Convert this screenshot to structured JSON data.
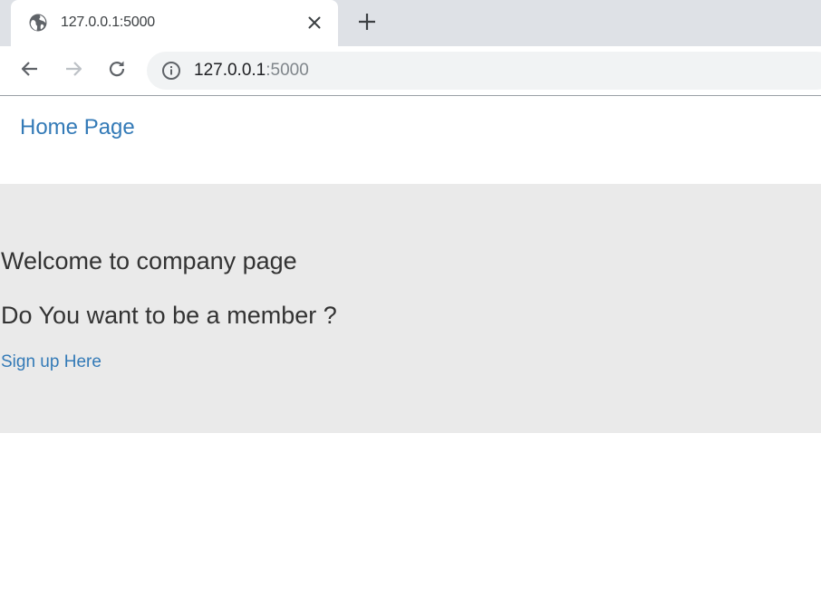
{
  "browser": {
    "tab": {
      "title": "127.0.0.1:5000",
      "favicon": "globe-icon"
    },
    "address": {
      "host": "127.0.0.1",
      "port": ":5000"
    }
  },
  "navbar": {
    "brand": "Home Page"
  },
  "jumbotron": {
    "heading": "Welcome to company page",
    "subheading": "Do You want to be a member ?",
    "link": "Sign up Here"
  },
  "colors": {
    "link": "#337ab7",
    "jumbotron_bg": "#eaeaea",
    "text": "#333333"
  }
}
